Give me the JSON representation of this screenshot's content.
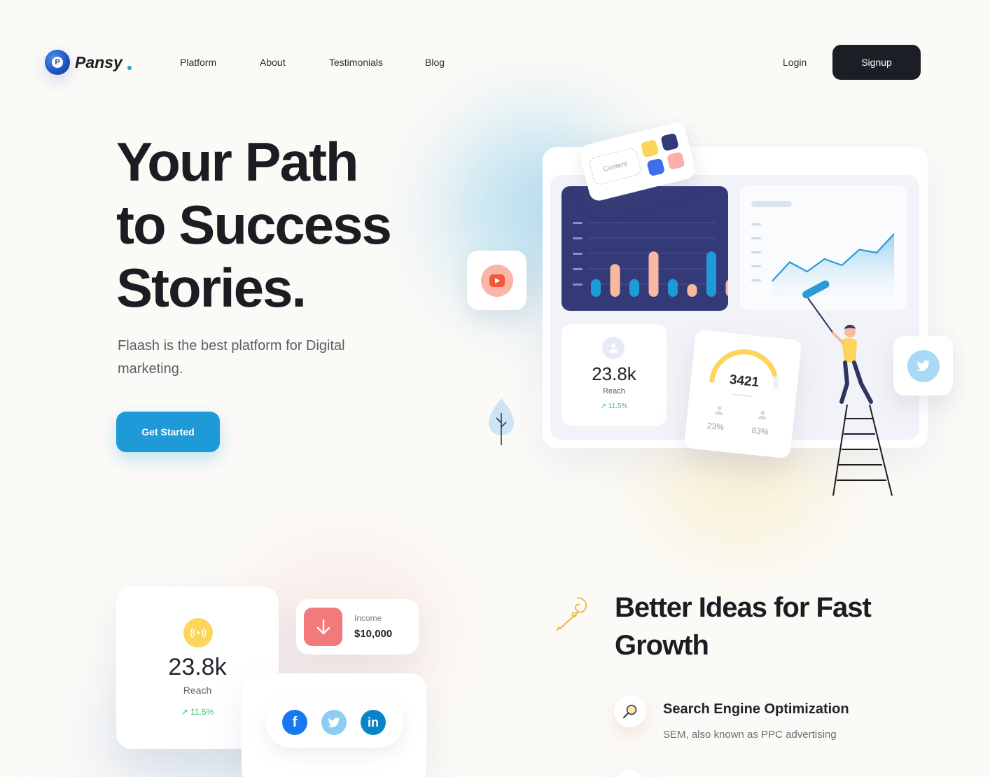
{
  "brand": {
    "name": "Pansy",
    "dot_color": "#21a0df"
  },
  "nav": {
    "items": [
      {
        "label": "Platform"
      },
      {
        "label": "About"
      },
      {
        "label": "Testimonials"
      },
      {
        "label": "Blog"
      }
    ],
    "login_label": "Login",
    "signup_label": "Signup"
  },
  "hero": {
    "title_lines": [
      "Your Path",
      "to Success",
      "Stories."
    ],
    "subtitle": "Flaash is the best platform for Digital marketing.",
    "cta_label": "Get Started",
    "accent_color": "#1f9ad8"
  },
  "illustration": {
    "content_label": "Content",
    "reach_value": "23.8k",
    "reach_label": "Reach",
    "reach_change": "11.5%",
    "gauge_value": "3421",
    "gauge_left_pct": "23%",
    "gauge_right_pct": "83%",
    "bar_levels": [
      0.28,
      0.52,
      0.28,
      0.72,
      0.28,
      0.2,
      0.72,
      0.28
    ],
    "line_levels": [
      0.15,
      0.45,
      0.3,
      0.5,
      0.4,
      0.65,
      0.6,
      0.9
    ],
    "icons": [
      "play-icon",
      "twitter-icon",
      "paint-roller-icon",
      "ladder-icon",
      "tree-icon"
    ]
  },
  "stats": {
    "reach_value": "23.8k",
    "reach_label": "Reach",
    "reach_change": "11.5%",
    "income_label": "Income",
    "income_value": "$10,000",
    "social_icons": [
      "facebook-icon",
      "twitter-icon",
      "linkedin-icon"
    ]
  },
  "features": {
    "title_lines": [
      "Better Ideas for Fast",
      "Growth"
    ],
    "items": [
      {
        "title": "Search Engine Optimization",
        "description": "SEM, also known as PPC advertising"
      }
    ]
  }
}
